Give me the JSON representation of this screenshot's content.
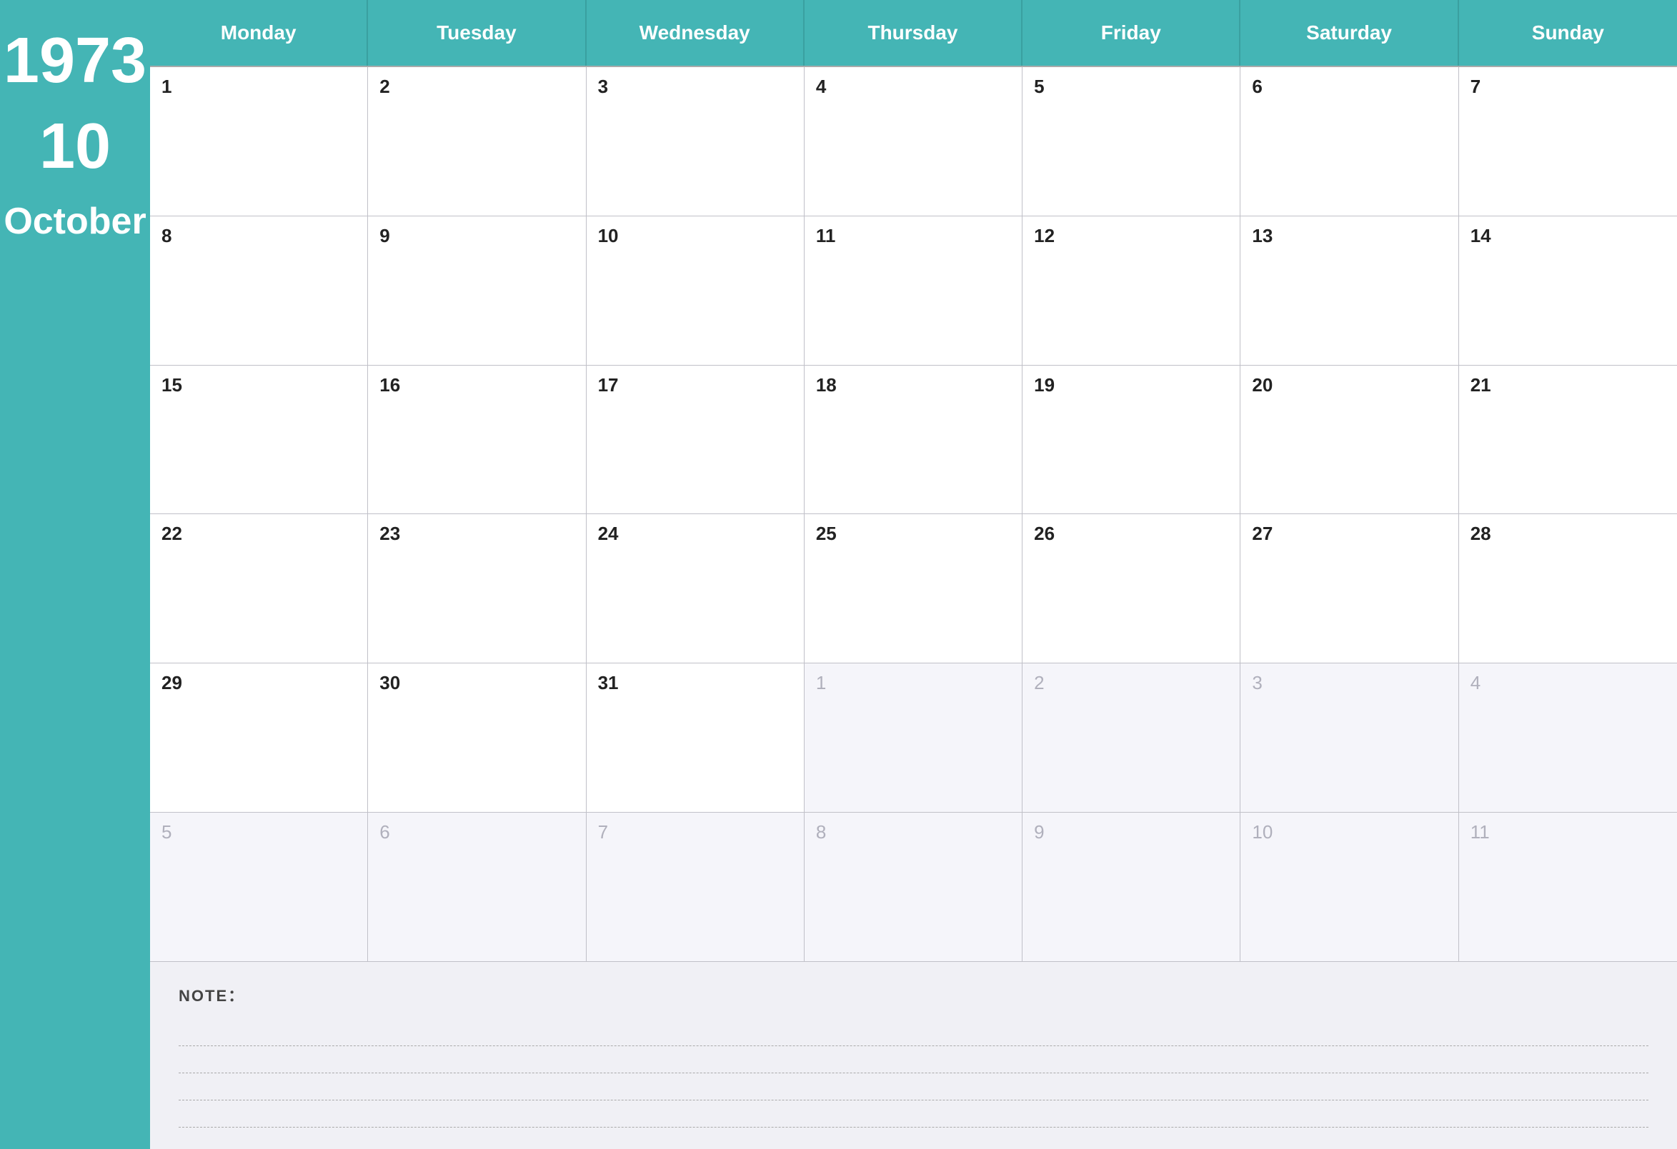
{
  "sidebar": {
    "year": "1973",
    "month_number": "10",
    "month_name": "October"
  },
  "day_headers": [
    "Monday",
    "Tuesday",
    "Wednesday",
    "Thursday",
    "Friday",
    "Saturday",
    "Sunday"
  ],
  "weeks": [
    [
      {
        "day": "1",
        "in_month": true
      },
      {
        "day": "2",
        "in_month": true
      },
      {
        "day": "3",
        "in_month": true
      },
      {
        "day": "4",
        "in_month": true
      },
      {
        "day": "5",
        "in_month": true
      },
      {
        "day": "6",
        "in_month": true
      },
      {
        "day": "7",
        "in_month": true
      }
    ],
    [
      {
        "day": "8",
        "in_month": true
      },
      {
        "day": "9",
        "in_month": true
      },
      {
        "day": "10",
        "in_month": true
      },
      {
        "day": "11",
        "in_month": true
      },
      {
        "day": "12",
        "in_month": true
      },
      {
        "day": "13",
        "in_month": true
      },
      {
        "day": "14",
        "in_month": true
      }
    ],
    [
      {
        "day": "15",
        "in_month": true
      },
      {
        "day": "16",
        "in_month": true
      },
      {
        "day": "17",
        "in_month": true
      },
      {
        "day": "18",
        "in_month": true
      },
      {
        "day": "19",
        "in_month": true
      },
      {
        "day": "20",
        "in_month": true
      },
      {
        "day": "21",
        "in_month": true
      }
    ],
    [
      {
        "day": "22",
        "in_month": true
      },
      {
        "day": "23",
        "in_month": true
      },
      {
        "day": "24",
        "in_month": true
      },
      {
        "day": "25",
        "in_month": true
      },
      {
        "day": "26",
        "in_month": true
      },
      {
        "day": "27",
        "in_month": true
      },
      {
        "day": "28",
        "in_month": true
      }
    ],
    [
      {
        "day": "29",
        "in_month": true
      },
      {
        "day": "30",
        "in_month": true
      },
      {
        "day": "31",
        "in_month": true
      },
      {
        "day": "1",
        "in_month": false
      },
      {
        "day": "2",
        "in_month": false
      },
      {
        "day": "3",
        "in_month": false
      },
      {
        "day": "4",
        "in_month": false
      }
    ],
    [
      {
        "day": "5",
        "in_month": false
      },
      {
        "day": "6",
        "in_month": false
      },
      {
        "day": "7",
        "in_month": false
      },
      {
        "day": "8",
        "in_month": false
      },
      {
        "day": "9",
        "in_month": false
      },
      {
        "day": "10",
        "in_month": false
      },
      {
        "day": "11",
        "in_month": false
      }
    ]
  ],
  "notes": {
    "label": "NOTE：",
    "line_count": 4
  }
}
